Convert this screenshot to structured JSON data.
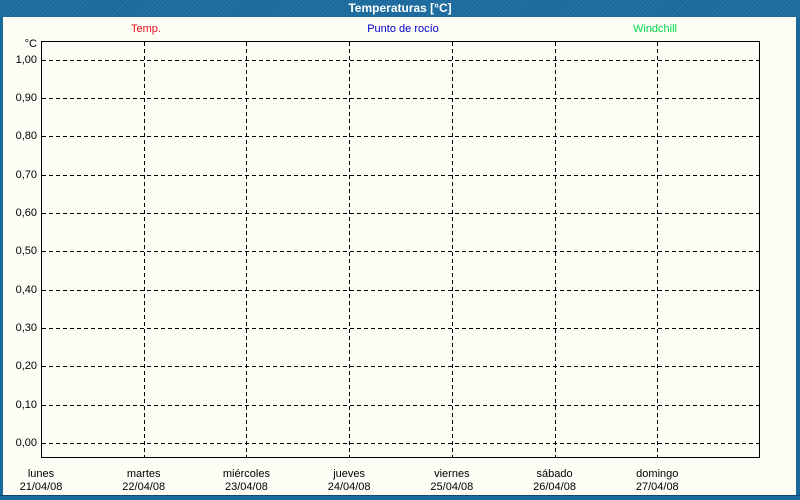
{
  "window": {
    "title": "Temperaturas [°C]"
  },
  "legend": [
    {
      "label": "Temp.",
      "color": "#e8101c"
    },
    {
      "label": "Punto de rocío",
      "color": "#0000cd"
    },
    {
      "label": "Windchill",
      "color": "#00d94c"
    }
  ],
  "chart_data": {
    "type": "line",
    "title": "Temperaturas [°C]",
    "ylabel": "°C",
    "ylim": [
      0.0,
      1.0
    ],
    "y_tick_step": 0.1,
    "y_ticks": [
      "1,00",
      "0,90",
      "0,80",
      "0,70",
      "0,60",
      "0,50",
      "0,40",
      "0,30",
      "0,20",
      "0,10",
      "0,00"
    ],
    "x_days": [
      {
        "weekday": "lunes",
        "date": "21/04/08"
      },
      {
        "weekday": "martes",
        "date": "22/04/08"
      },
      {
        "weekday": "miércoles",
        "date": "23/04/08"
      },
      {
        "weekday": "jueves",
        "date": "24/04/08"
      },
      {
        "weekday": "viernes",
        "date": "25/04/08"
      },
      {
        "weekday": "sábado",
        "date": "26/04/08"
      },
      {
        "weekday": "domingo",
        "date": "27/04/08"
      }
    ],
    "series": [
      {
        "name": "Temp.",
        "color": "#e8101c",
        "values": []
      },
      {
        "name": "Punto de rocío",
        "color": "#0000cd",
        "values": []
      },
      {
        "name": "Windchill",
        "color": "#00d94c",
        "values": []
      }
    ],
    "grid": {
      "style": "dashed",
      "horizontal": true,
      "vertical": true
    },
    "legend_position": "top",
    "colors": {
      "frame": "#1a699c",
      "plot_border": "#000000",
      "background": "#fdfdf6"
    }
  }
}
